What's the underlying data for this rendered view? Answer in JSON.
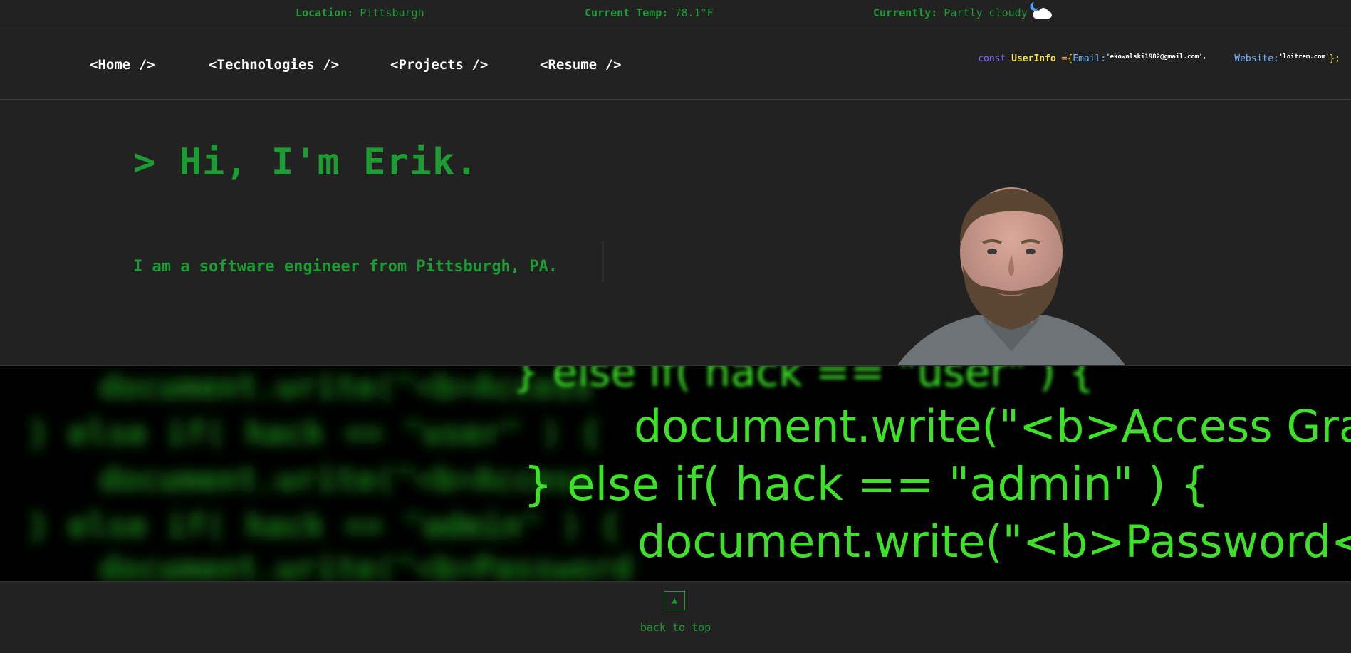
{
  "weather": {
    "location_label": "Location:",
    "location_value": "Pittsburgh",
    "temp_label": "Current Temp:",
    "temp_value": "78.1°F",
    "condition_label": "Currently:",
    "condition_value": "Partly cloudy",
    "condition_icon": "partly-cloudy-night-icon"
  },
  "nav": {
    "items": [
      {
        "label": "<Home />"
      },
      {
        "label": "<Technologies />"
      },
      {
        "label": "<Projects />"
      },
      {
        "label": "<Resume />"
      }
    ]
  },
  "userinfo": {
    "keyword": "const",
    "name": "UserInfo",
    "equals": "=",
    "open": "{",
    "email_key": "Email:",
    "email_value": "'ekowalski1982@gmail.com',",
    "website_key": "Website:",
    "website_value": "'loitrem.com'",
    "close": "};"
  },
  "hero": {
    "title": "> Hi, I'm Erik.",
    "subtitle": "I am a software engineer from Pittsburgh, PA."
  },
  "banner": {
    "lines": [
      "} else if( hack == \"user\" ) {",
      "document.write(\"<b>Access Granted\");",
      "} else if( hack == \"admin\" ) {",
      "document.write(\"<b>Password</b>\");"
    ]
  },
  "footer": {
    "arrow": "▲",
    "back_to_top": "back to top"
  },
  "colors": {
    "background": "#222222",
    "accent_green": "#1e9c34",
    "banner_green": "#3ee02a"
  }
}
